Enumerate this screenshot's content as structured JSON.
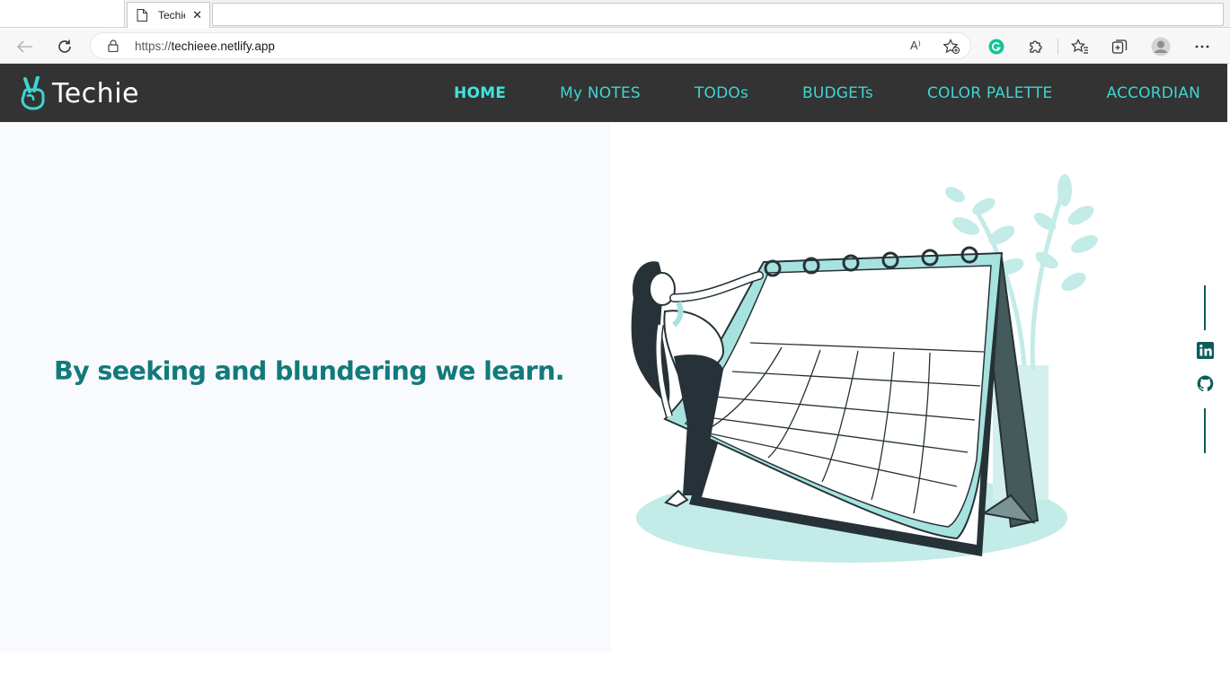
{
  "browser": {
    "tab_title": "Techie",
    "tab_close": "✕",
    "url_protocol": "https://",
    "url_host": "techieee.netlify.app",
    "read_aloud": "A⁾"
  },
  "site": {
    "brand": "Techie",
    "nav": [
      {
        "label": "HOME",
        "active": true
      },
      {
        "label": "My NOTES",
        "active": false
      },
      {
        "label": "TODOs",
        "active": false
      },
      {
        "label": "BUDGETs",
        "active": false
      },
      {
        "label": "COLOR PALETTE",
        "active": false
      },
      {
        "label": "ACCORDIAN",
        "active": false
      }
    ],
    "accent": "#3fe3de",
    "nav_bg": "#333333"
  },
  "hero": {
    "tagline": "By seeking and blundering we learn.",
    "tagline_color": "#127a7a"
  },
  "social": {
    "icons": [
      "linkedin-icon",
      "github-icon"
    ]
  }
}
